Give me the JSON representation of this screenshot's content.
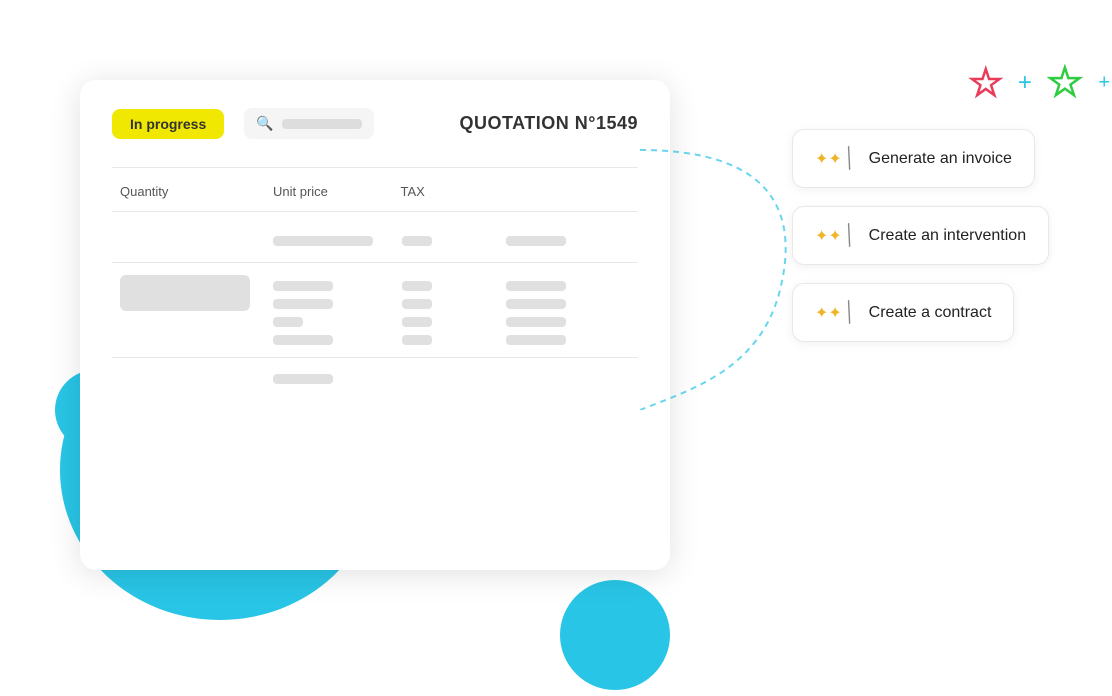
{
  "status": {
    "label": "In progress",
    "color": "#f0e800"
  },
  "search": {
    "placeholder": ""
  },
  "quotation": {
    "title": "QUOTATION  N°1549"
  },
  "table": {
    "headers": [
      "Quantity",
      "Unit price",
      "TAX",
      ""
    ],
    "skeletonRows": [
      {
        "col1": "sm",
        "col2": "md",
        "col3": "sm",
        "col4": "md"
      },
      {
        "col1": "xl",
        "col2": "md",
        "col3": "sm",
        "col4": "md"
      },
      {
        "col1": "",
        "col2": "md",
        "col3": "sm",
        "col4": "md"
      },
      {
        "col1": "",
        "col2": "sm",
        "col3": "sm",
        "col4": "md"
      },
      {
        "col1": "",
        "col2": "md",
        "col3": "",
        "col4": ""
      }
    ]
  },
  "actions": [
    {
      "id": "generate-invoice",
      "label": "Generate an invoice",
      "icon": "✦ ✦ /"
    },
    {
      "id": "create-intervention",
      "label": "Create an intervention",
      "icon": "✦ ✦ /"
    },
    {
      "id": "create-contract",
      "label": "Create a contract",
      "icon": "✦ ✦ /"
    }
  ],
  "decorators": {
    "plus_blue": "+",
    "plus_blue_sm": "+",
    "star_red": "☆",
    "star_green": "☆"
  }
}
